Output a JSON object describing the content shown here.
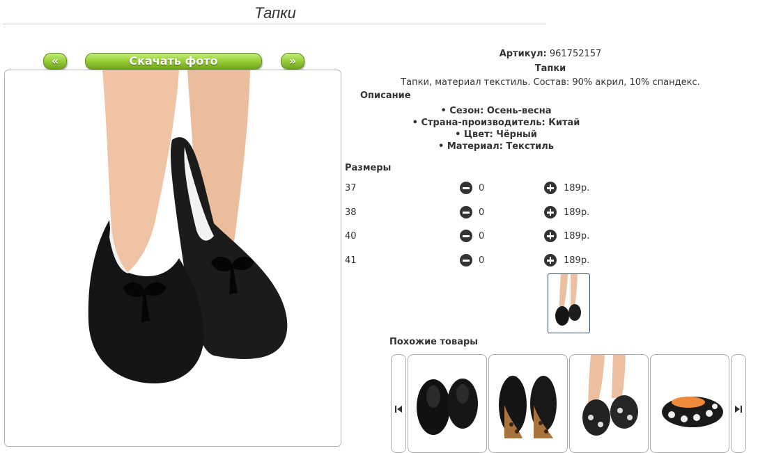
{
  "page": {
    "title": "Тапки"
  },
  "gallery": {
    "prev_label": "«",
    "download_label": "Скачать фото",
    "next_label": "»"
  },
  "product": {
    "article_label": "Артикул:",
    "article_value": "961752157",
    "name": "Тапки",
    "summary": "Тапки, материал текстиль. Состав: 90% акрил, 10% спандекс.",
    "description_heading": "Описание",
    "properties": [
      "Сезон: Осень-весна",
      "Страна-производитель: Китай",
      "Цвет: Чёрный",
      "Материал: Текстиль"
    ]
  },
  "sizes": {
    "heading": "Размеры",
    "rows": [
      {
        "size": "37",
        "qty": "0",
        "price": "189р."
      },
      {
        "size": "38",
        "qty": "0",
        "price": "189р."
      },
      {
        "size": "40",
        "qty": "0",
        "price": "189р."
      },
      {
        "size": "41",
        "qty": "0",
        "price": "189р."
      }
    ]
  },
  "similar": {
    "heading": "Похожие товары"
  },
  "icons": {
    "minus": "minus-circle-icon",
    "plus": "plus-circle-icon",
    "carousel_prev": "skip-back-icon",
    "carousel_next": "skip-forward-icon"
  },
  "colors": {
    "button_green": "#8cc63f",
    "thumb_border": "#2f4a68"
  }
}
